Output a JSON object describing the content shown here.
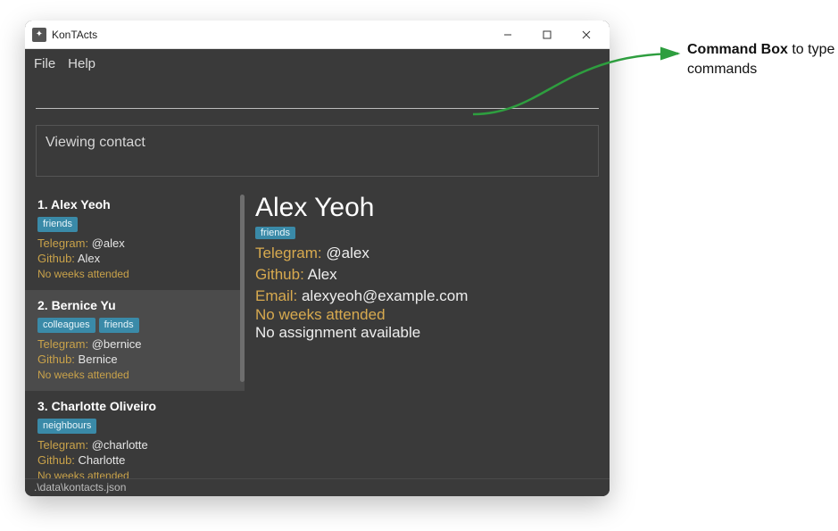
{
  "window": {
    "title": "KonTActs"
  },
  "menubar": {
    "file": "File",
    "help": "Help"
  },
  "command": {
    "value": ""
  },
  "result": {
    "text": "Viewing contact"
  },
  "contacts": [
    {
      "index": "1.",
      "name": "Alex Yeoh",
      "tags": [
        "friends"
      ],
      "telegram_label": "Telegram:",
      "telegram": "@alex",
      "github_label": "Github:",
      "github": "Alex",
      "weeks": "No weeks attended",
      "selected": false
    },
    {
      "index": "2.",
      "name": "Bernice Yu",
      "tags": [
        "colleagues",
        "friends"
      ],
      "telegram_label": "Telegram:",
      "telegram": "@bernice",
      "github_label": "Github:",
      "github": "Bernice",
      "weeks": "No weeks attended",
      "selected": true
    },
    {
      "index": "3.",
      "name": "Charlotte Oliveiro",
      "tags": [
        "neighbours"
      ],
      "telegram_label": "Telegram:",
      "telegram": "@charlotte",
      "github_label": "Github:",
      "github": "Charlotte",
      "weeks": "No weeks attended",
      "selected": false
    }
  ],
  "detail": {
    "name": "Alex Yeoh",
    "tags": [
      "friends"
    ],
    "telegram_label": "Telegram:",
    "telegram": "@alex",
    "github_label": "Github:",
    "github": "Alex",
    "email_label": "Email:",
    "email": "alexyeoh@example.com",
    "weeks": "No weeks attended",
    "assignment": "No assignment available"
  },
  "status": {
    "path": ".\\data\\kontacts.json"
  },
  "annotation": {
    "bold": "Command Box",
    "rest": " to type commands"
  }
}
